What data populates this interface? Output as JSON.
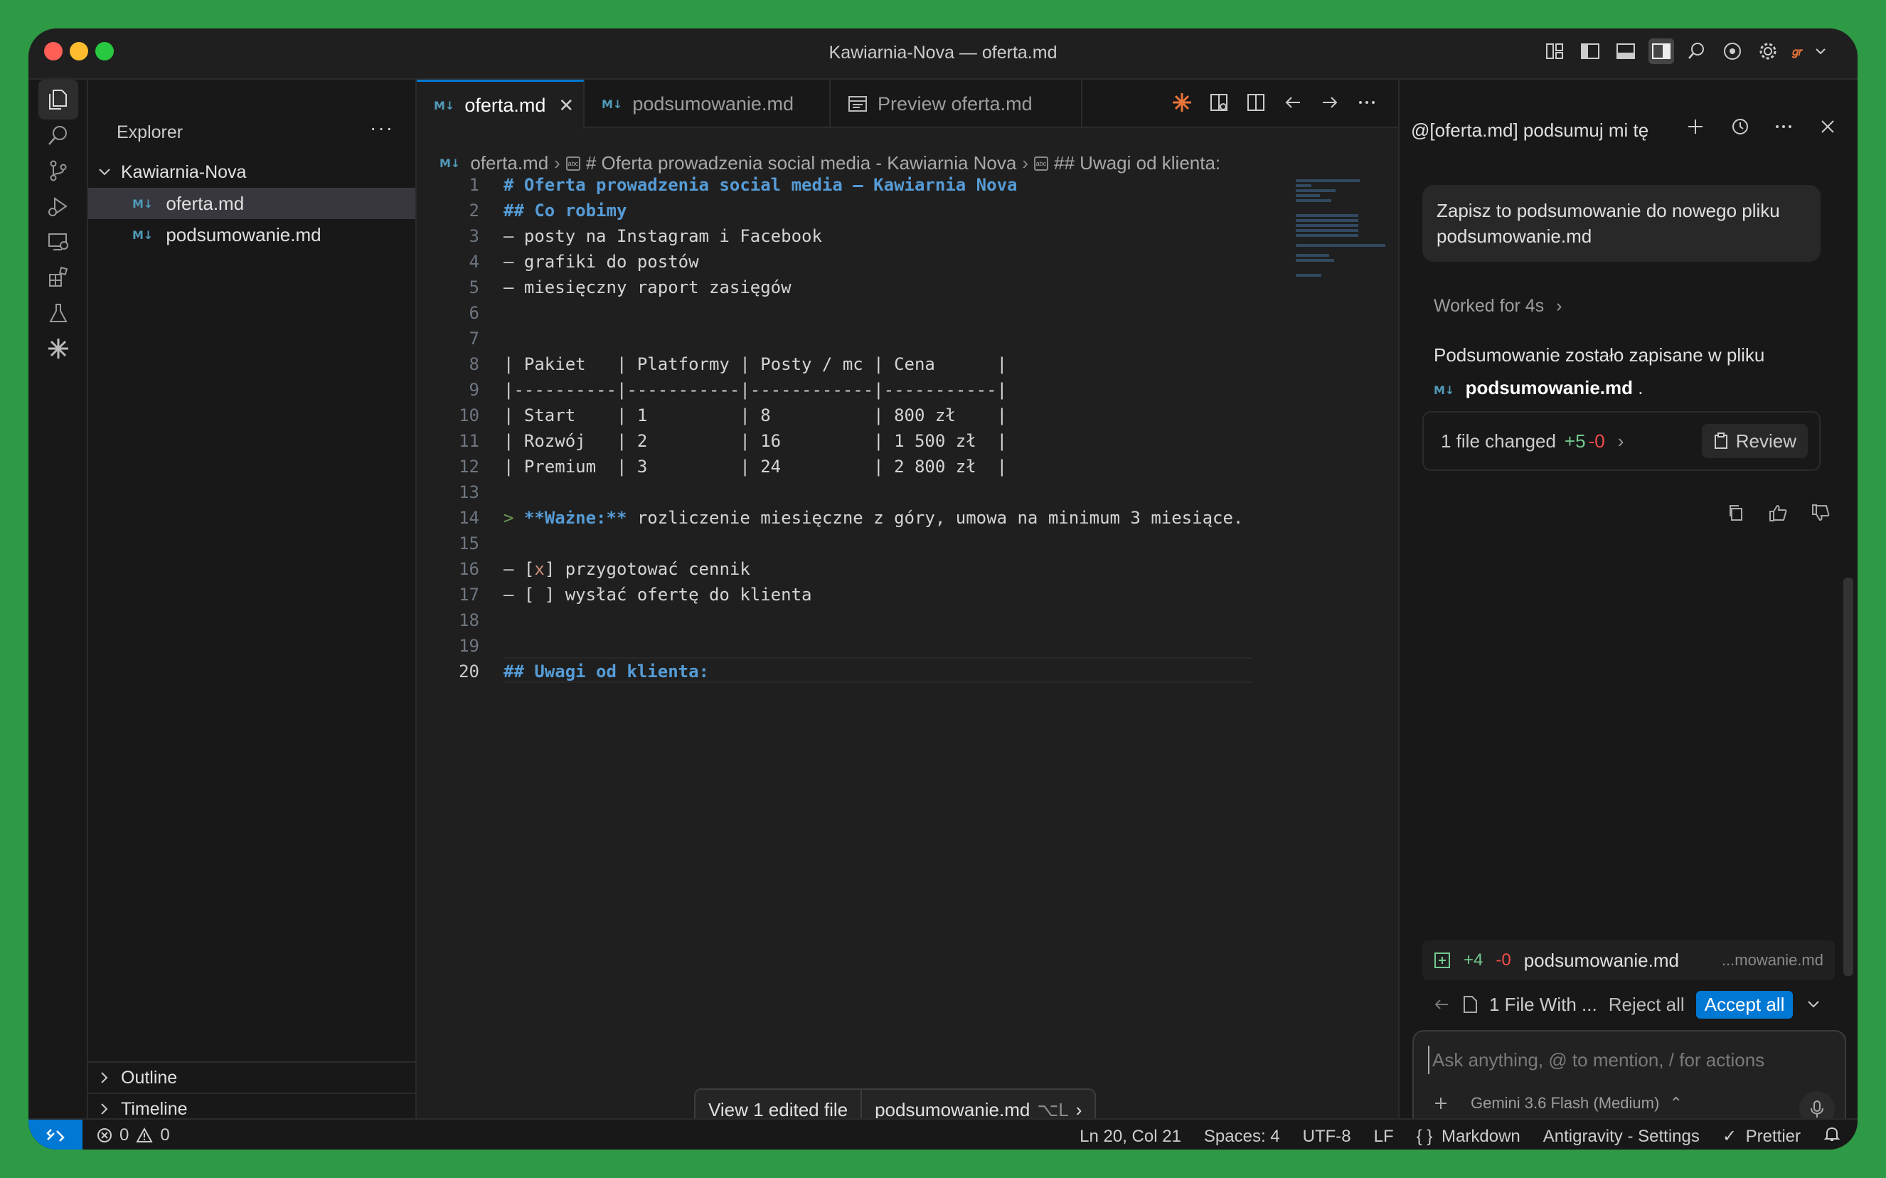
{
  "window": {
    "title": "Kawiarnia-Nova — oferta.md"
  },
  "explorer": {
    "header": "Explorer",
    "more": "···",
    "root": "Kawiarnia-Nova",
    "files": [
      "oferta.md",
      "podsumowanie.md"
    ],
    "outline": "Outline",
    "timeline": "Timeline"
  },
  "tabs": [
    {
      "label": "oferta.md",
      "close": "✕"
    },
    {
      "label": "podsumowanie.md"
    },
    {
      "label": "Preview oferta.md"
    }
  ],
  "breadcrumb": [
    "oferta.md",
    "# Oferta prowadzenia social media - Kawiarnia Nova",
    "## Uwagi od klienta:"
  ],
  "code": {
    "line_numbers": [
      "1",
      "2",
      "3",
      "4",
      "5",
      "6",
      "7",
      "8",
      "9",
      "10",
      "11",
      "12",
      "13",
      "14",
      "15",
      "16",
      "17",
      "18",
      "19",
      "20"
    ],
    "lines": [
      "# Oferta prowadzenia social media – Kawiarnia Nova",
      "## Co robimy",
      "– posty na Instagram i Facebook",
      "– grafiki do postów",
      "– miesięczny raport zasięgów",
      "",
      "",
      "| Pakiet   | Platformy | Posty / mc | Cena      |",
      "|----------|-----------|------------|-----------|",
      "| Start    | 1         | 8          | 800 zł    |",
      "| Rozwój   | 2         | 16         | 1 500 zł  |",
      "| Premium  | 3         | 24         | 2 800 zł  |",
      "",
      "",
      "",
      "",
      "– [ ] wysłać ofertę do klienta",
      "",
      "",
      "## Uwagi od klienta:"
    ],
    "line14": {
      "marker": "> ",
      "bold": "**Ważne:**",
      "rest": " rozliczenie miesięczne z góry, umowa na minimum 3 miesiące."
    },
    "line16": {
      "prefix": "– [",
      "x": "x",
      "rest": "] przygotować cennik"
    }
  },
  "float_bar": {
    "view": "View 1 edited file",
    "file": "podsumowanie.md",
    "shortcut": "⌥L",
    "chev": "›"
  },
  "agent": {
    "header": "@[oferta.md] podsumuj mi tę",
    "user_message": "Zapisz to podsumowanie do nowego pliku podsumowanie.md",
    "worked": "Worked for 4s",
    "worked_chev": "›",
    "response_text": "Podsumowanie zostało zapisane w pliku",
    "response_file": "podsumowanie.md",
    "response_dot": ".",
    "changed": "1 file changed",
    "plus": "+5",
    "minus": "-0",
    "chev": "›",
    "review": "Review",
    "file_row": {
      "plus": "+4",
      "minus": "-0",
      "name": "podsumowanie.md",
      "path": "...mowanie.md"
    },
    "accept_row": {
      "label": "1 File With ...",
      "reject": "Reject all",
      "accept": "Accept all"
    },
    "input_placeholder": "Ask anything, @ to mention, / for actions",
    "model": "Gemini 3.6 Flash (Medium)"
  },
  "status": {
    "errors": "0",
    "warnings": "0",
    "position": "Ln 20, Col 21",
    "spaces": "Spaces: 4",
    "encoding": "UTF-8",
    "eol": "LF",
    "language": "Markdown",
    "settings": "Antigravity - Settings",
    "prettier": "Prettier"
  },
  "colors": {
    "accent": "#0078d4",
    "heading": "#569cd6",
    "quote": "#6a9955",
    "added": "#73c991",
    "removed": "#f14c4c"
  }
}
